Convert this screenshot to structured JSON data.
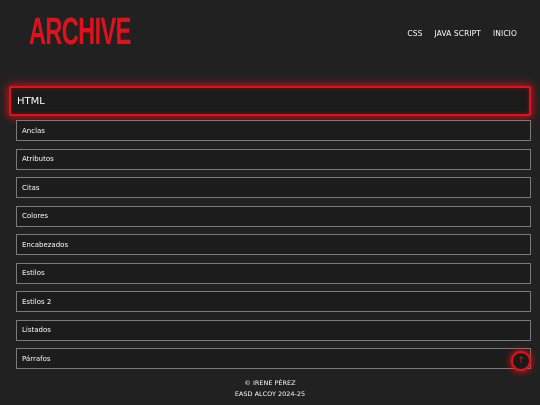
{
  "header": {
    "logo": "ARCHIVE",
    "nav": [
      "CSS",
      "JAVA SCRIPT",
      "INICIO"
    ]
  },
  "section": {
    "title": "HTML",
    "items": [
      "Anclas",
      "Atributos",
      "Citas",
      "Colores",
      "Encabezados",
      "Estilos",
      "Estilos 2",
      "Listados",
      "Párrafos"
    ]
  },
  "scroll_top": {
    "icon": "arrow-up-icon",
    "glyph": "↑"
  },
  "footer": {
    "line1": "© IRENE PÉREZ",
    "line2": "EASD ALCOY 2024-25"
  },
  "colors": {
    "accent": "#e0111b",
    "background": "#212121",
    "border": "#7a7a7a"
  }
}
